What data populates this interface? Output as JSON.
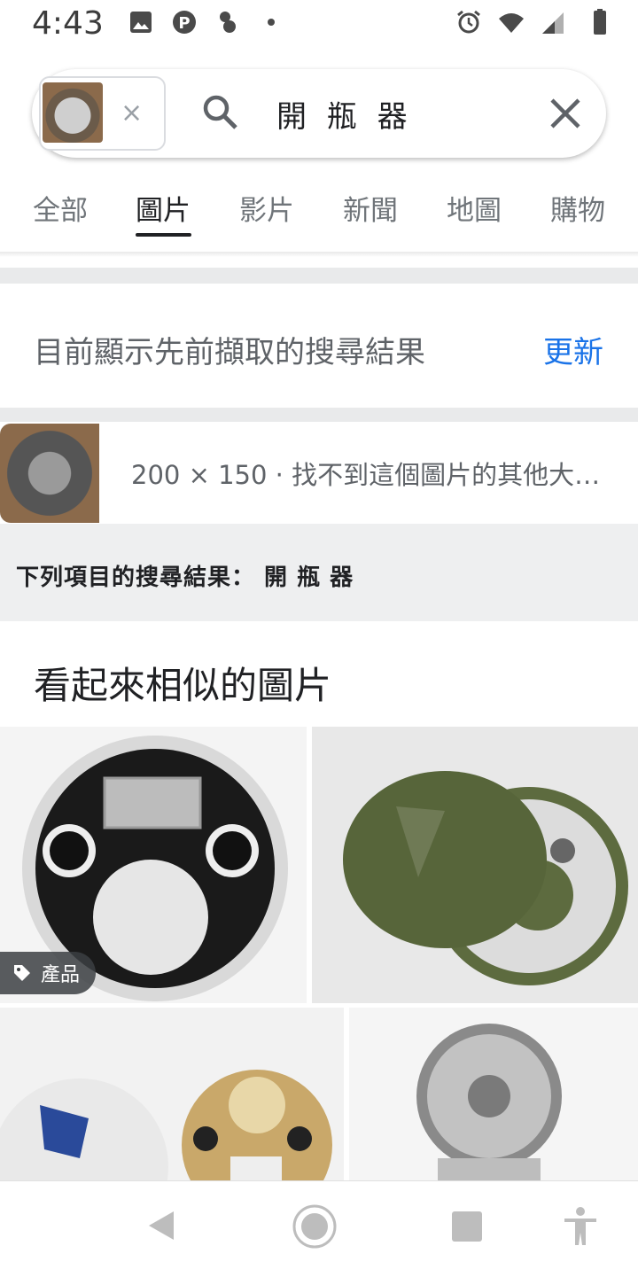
{
  "status_bar": {
    "time": "4:43"
  },
  "search": {
    "query": "開 瓶 器",
    "chip_clear": "×"
  },
  "tabs": [
    {
      "label": "全部"
    },
    {
      "label": "圖片"
    },
    {
      "label": "影片"
    },
    {
      "label": "新聞"
    },
    {
      "label": "地圖"
    },
    {
      "label": "購物"
    }
  ],
  "notice": {
    "text": "目前顯示先前擷取的搜尋結果",
    "refresh_label": "更新"
  },
  "image_info": {
    "text": "200 × 150 · 找不到這個圖片的其他大…"
  },
  "results_for": {
    "text": "下列項目的搜尋結果： 開 瓶 器"
  },
  "similar": {
    "title": "看起來相似的圖片",
    "badge": "產品"
  },
  "colors": {
    "accent": "#1a73e8",
    "badge_bg": "#3c4043"
  }
}
